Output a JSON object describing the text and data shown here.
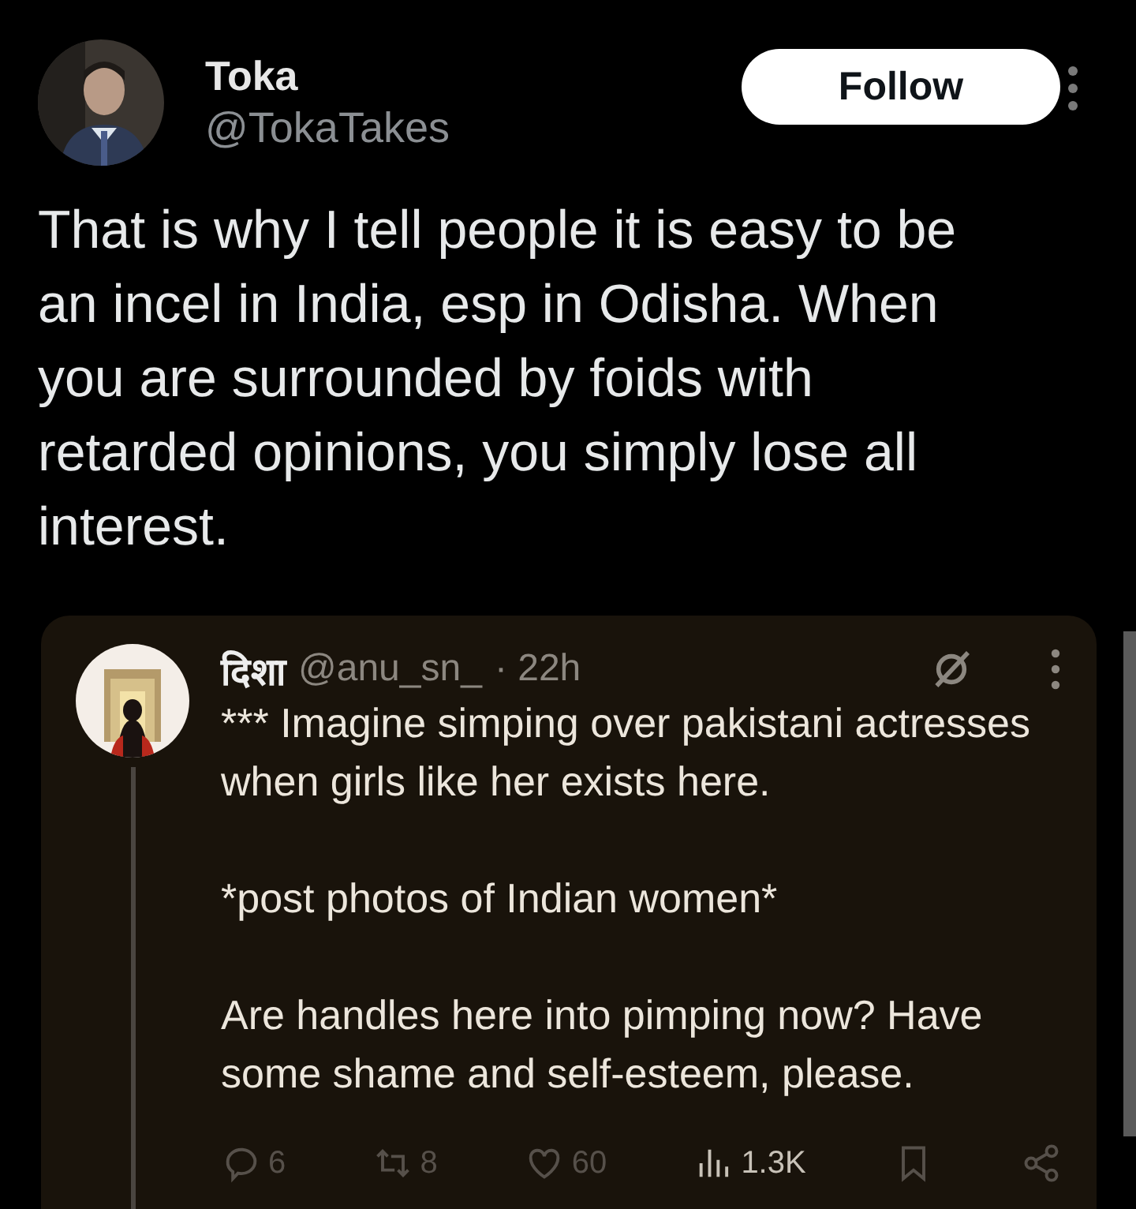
{
  "post": {
    "name": "Toka",
    "handle": "@TokaTakes",
    "follow_label": "Follow",
    "text": "That is why I tell people it is easy to be an incel in India, esp in Odisha. When you are surrounded by foids with retarded opinions, you simply lose all interest."
  },
  "quoted": {
    "name": "दिशा",
    "handle": "@anu_sn_",
    "time": "· 22h",
    "paragraphs": [
      "*** Imagine simping over pakistani actresses when girls like her exists here.",
      "*post photos of Indian women*",
      "Are handles here into pimping now? Have some shame and self-esteem, please."
    ],
    "actions": [
      {
        "kind": "reply",
        "count": "6"
      },
      {
        "kind": "repost",
        "count": "8"
      },
      {
        "kind": "like",
        "count": "60"
      },
      {
        "kind": "views",
        "count": "1.3K"
      },
      {
        "kind": "bookmark"
      },
      {
        "kind": "share"
      }
    ]
  }
}
